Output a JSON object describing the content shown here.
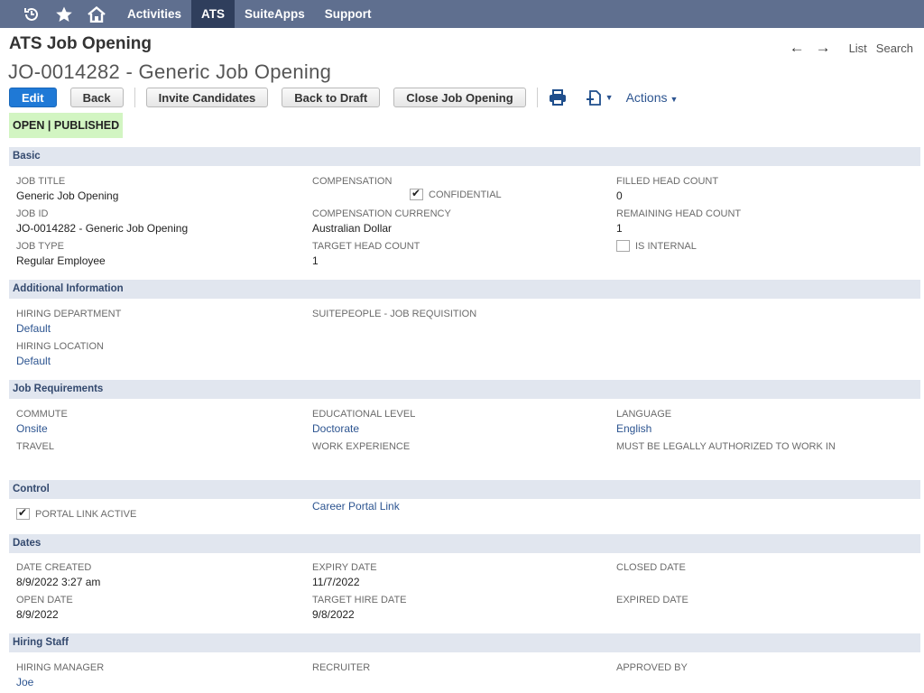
{
  "nav": {
    "items": [
      "Activities",
      "ATS",
      "SuiteApps",
      "Support"
    ],
    "active_index": 1
  },
  "header": {
    "record_type": "ATS Job Opening",
    "record_title": "JO-0014282 - Generic Job Opening",
    "list_link": "List",
    "search_link": "Search"
  },
  "toolbar": {
    "edit": "Edit",
    "back": "Back",
    "invite": "Invite Candidates",
    "back_to_draft": "Back to Draft",
    "close": "Close Job Opening",
    "actions": "Actions"
  },
  "status": "OPEN | PUBLISHED",
  "sections": {
    "basic": {
      "title": "Basic",
      "job_title_label": "JOB TITLE",
      "job_title": "Generic Job Opening",
      "job_id_label": "JOB ID",
      "job_id": "JO-0014282 - Generic Job Opening",
      "job_type_label": "JOB TYPE",
      "job_type": "Regular Employee",
      "compensation_label": "COMPENSATION",
      "confidential_label": "CONFIDENTIAL",
      "confidential_checked": true,
      "comp_currency_label": "COMPENSATION CURRENCY",
      "comp_currency": "Australian Dollar",
      "target_head_count_label": "TARGET HEAD COUNT",
      "target_head_count": "1",
      "filled_head_count_label": "FILLED HEAD COUNT",
      "filled_head_count": "0",
      "remaining_head_count_label": "REMAINING HEAD COUNT",
      "remaining_head_count": "1",
      "is_internal_label": "IS INTERNAL",
      "is_internal_checked": false
    },
    "additional": {
      "title": "Additional Information",
      "hiring_department_label": "HIRING DEPARTMENT",
      "hiring_department": "Default",
      "hiring_location_label": "HIRING LOCATION",
      "hiring_location": "Default",
      "suitepeople_label": "SUITEPEOPLE - JOB REQUISITION"
    },
    "requirements": {
      "title": "Job Requirements",
      "commute_label": "COMMUTE",
      "commute": "Onsite",
      "travel_label": "TRAVEL",
      "education_label": "EDUCATIONAL LEVEL",
      "education": "Doctorate",
      "work_experience_label": "WORK EXPERIENCE",
      "language_label": "LANGUAGE",
      "language": "English",
      "authorized_label": "MUST BE LEGALLY AUTHORIZED TO WORK IN"
    },
    "control": {
      "title": "Control",
      "portal_link_active_label": "PORTAL LINK ACTIVE",
      "portal_link_active_checked": true,
      "career_portal_link": "Career Portal Link"
    },
    "dates": {
      "title": "Dates",
      "date_created_label": "DATE CREATED",
      "date_created": "8/9/2022 3:27 am",
      "open_date_label": "OPEN DATE",
      "open_date": "8/9/2022",
      "expiry_date_label": "EXPIRY DATE",
      "expiry_date": "11/7/2022",
      "target_hire_date_label": "TARGET HIRE DATE",
      "target_hire_date": "9/8/2022",
      "closed_date_label": "CLOSED DATE",
      "expired_date_label": "EXPIRED DATE"
    },
    "hiring_staff": {
      "title": "Hiring Staff",
      "hiring_manager_label": "HIRING MANAGER",
      "hiring_manager": "Joe",
      "recruiter_label": "RECRUITER",
      "approved_by_label": "APPROVED BY"
    }
  }
}
